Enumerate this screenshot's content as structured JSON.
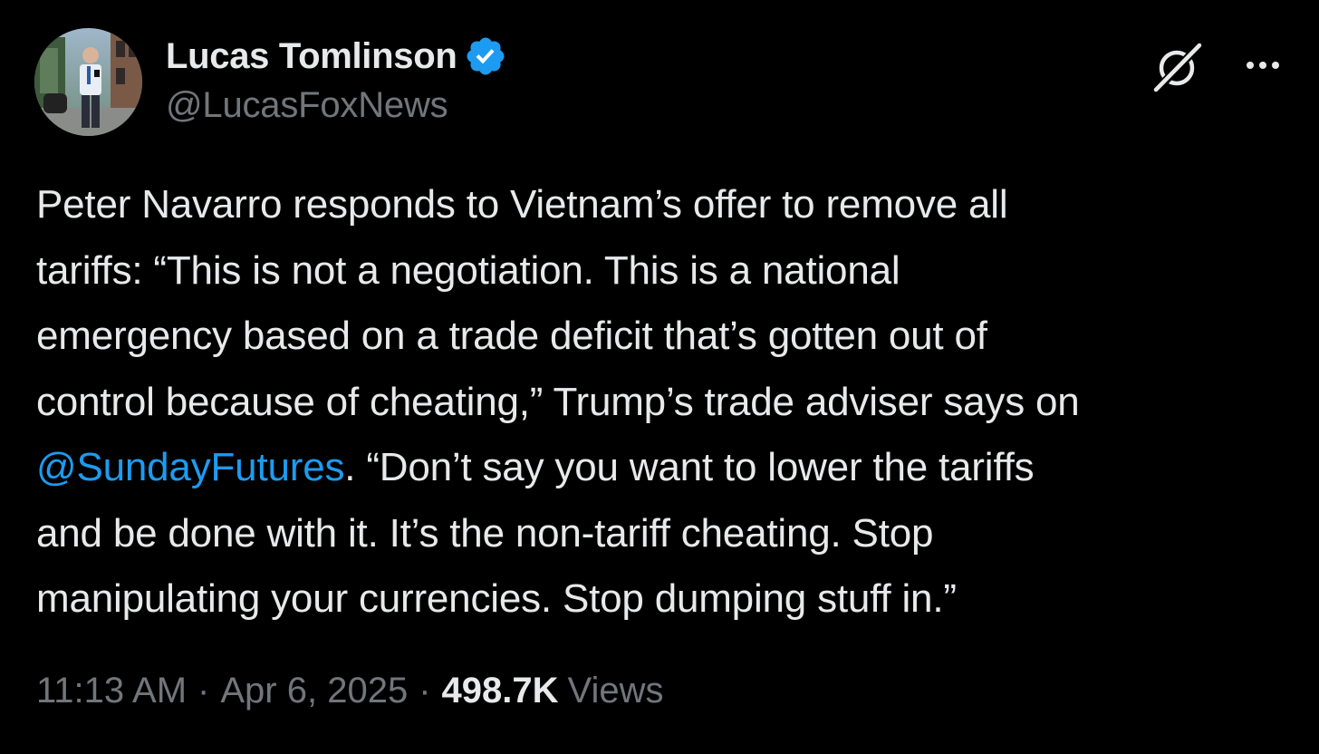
{
  "author": {
    "display_name": "Lucas Tomlinson",
    "handle": "@LucasFoxNews",
    "verified_icon": "verified-badge-icon",
    "verified_color": "#1d9bf0"
  },
  "actions": {
    "grok_icon": "grok-icon",
    "more_icon": "more-options-icon"
  },
  "tweet": {
    "line1": "Peter Navarro responds to Vietnam’s offer to remove all",
    "line2": "tariffs: “This is not a negotiation. This is a national",
    "line3": "emergency based on a trade deficit that’s gotten out of",
    "line4": "control because of cheating,” Trump’s trade adviser says on",
    "mention": "@SundayFutures",
    "line5_rest": ". “Don’t say you want to lower the tariffs",
    "line6": "and be done with it. It’s the non-tariff cheating. Stop",
    "line7": "manipulating your currencies. Stop dumping stuff in.”"
  },
  "meta": {
    "time": "11:13 AM",
    "separator": "·",
    "date": "Apr 6, 2025",
    "views_count": "498.7K",
    "views_label": "Views"
  },
  "colors": {
    "background": "#000000",
    "primary_text": "#e7e9ea",
    "secondary_text": "#71767b",
    "accent": "#1d9bf0"
  }
}
